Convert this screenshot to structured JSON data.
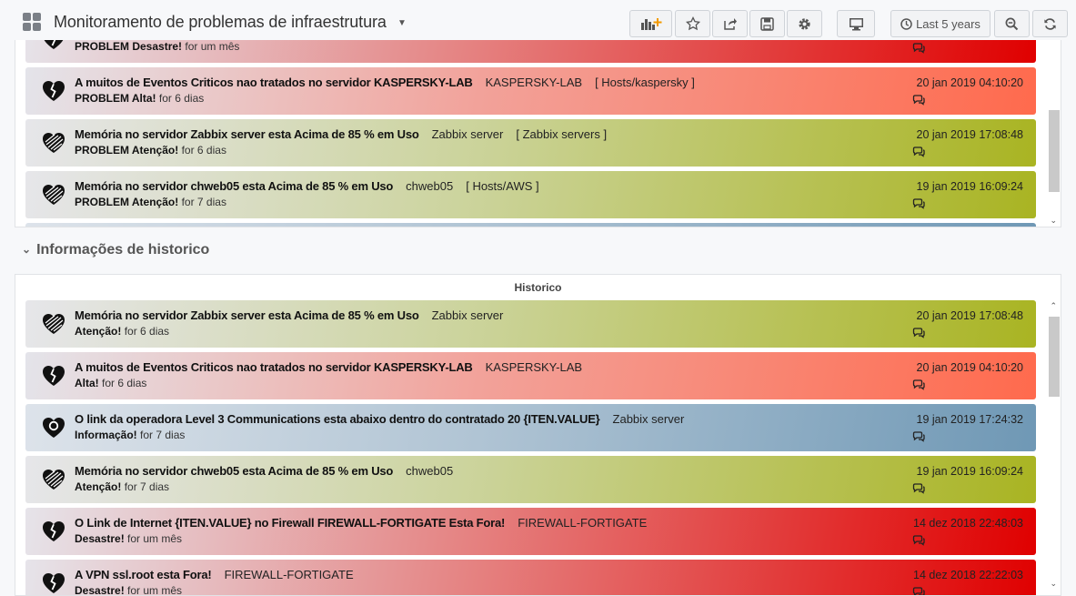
{
  "header": {
    "title": "Monitoramento de problemas de infraestrutura",
    "time_range": "Last 5 years"
  },
  "row": {
    "title": "Informações de historico"
  },
  "panel_problems": {
    "title": "",
    "alerts": [
      {
        "severity": "disaster",
        "title": "",
        "host": "",
        "group": "",
        "status": "PROBLEM Desastre!",
        "age": "for um mês",
        "time": ""
      },
      {
        "severity": "high",
        "title": "A muitos de Eventos Criticos nao tratados no servidor KASPERSKY-LAB",
        "host": "KASPERSKY-LAB",
        "group": "[ Hosts/kaspersky ]",
        "status": "PROBLEM Alta!",
        "age": "for 6 dias",
        "time": "20 jan 2019 04:10:20"
      },
      {
        "severity": "warning",
        "title": "Memória no servidor Zabbix server esta Acima de 85 % em Uso",
        "host": "Zabbix server",
        "group": "[ Zabbix servers ]",
        "status": "PROBLEM Atenção!",
        "age": "for 6 dias",
        "time": "20 jan 2019 17:08:48"
      },
      {
        "severity": "warning",
        "title": "Memória no servidor chweb05 esta Acima de 85 % em Uso",
        "host": "chweb05",
        "group": "[ Hosts/AWS ]",
        "status": "PROBLEM Atenção!",
        "age": "for 7 dias",
        "time": "19 jan 2019 16:09:24"
      }
    ]
  },
  "panel_history": {
    "title": "Historico",
    "alerts": [
      {
        "severity": "warning",
        "title": "Memória no servidor Zabbix server esta Acima de 85 % em Uso",
        "host": "Zabbix server",
        "status": "Atenção!",
        "age": "for 6 dias",
        "time": "20 jan 2019 17:08:48"
      },
      {
        "severity": "high",
        "title": "A muitos de Eventos Criticos nao tratados no servidor KASPERSKY-LAB",
        "host": "KASPERSKY-LAB",
        "status": "Alta!",
        "age": "for 6 dias",
        "time": "20 jan 2019 04:10:20"
      },
      {
        "severity": "info",
        "title": "O link da operadora Level 3 Communications esta abaixo dentro do contratado 20 {ITEN.VALUE}",
        "host": "Zabbix server",
        "status": "Informação!",
        "age": "for 7 dias",
        "time": "19 jan 2019 17:24:32"
      },
      {
        "severity": "warning",
        "title": "Memória no servidor chweb05 esta Acima de 85 % em Uso",
        "host": "chweb05",
        "status": "Atenção!",
        "age": "for 7 dias",
        "time": "19 jan 2019 16:09:24"
      },
      {
        "severity": "disaster",
        "title": "O Link de Internet {ITEN.VALUE} no Firewall FIREWALL-FORTIGATE Esta Fora!",
        "host": "FIREWALL-FORTIGATE",
        "status": "Desastre!",
        "age": "for um mês",
        "time": "14 dez 2018 22:48:03"
      },
      {
        "severity": "disaster",
        "title": "A VPN ssl.root esta Fora!",
        "host": "FIREWALL-FORTIGATE",
        "status": "Desastre!",
        "age": "for um mês",
        "time": "14 dez 2018 22:22:03"
      }
    ]
  },
  "colors": {
    "high": "#ff6a4d",
    "warning": "#a9b422",
    "disaster": "#e00000",
    "info": "#6f98b5"
  },
  "icons": {
    "problem": "broken-heart-icon",
    "warning": "striped-heart-icon",
    "info": "heart-with-circle-icon",
    "comment": "comments-icon"
  }
}
